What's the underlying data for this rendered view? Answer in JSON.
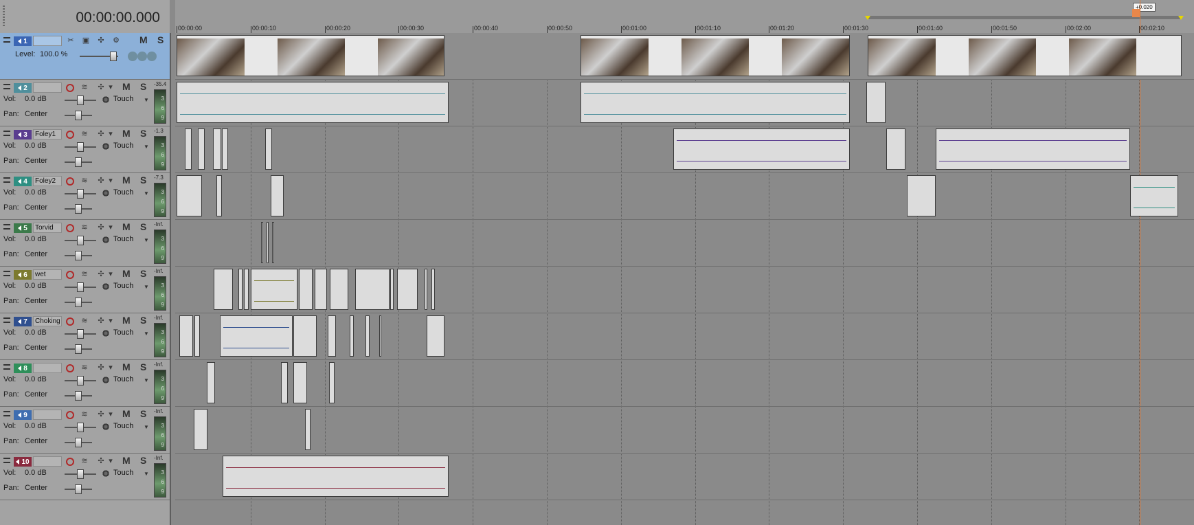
{
  "header": {
    "timecode": "00:00:00.000"
  },
  "ruler": {
    "ticks": [
      "00:00:00",
      "00:00:10",
      "00:00:20",
      "00:00:30",
      "00:00:40",
      "00:00:50",
      "00:01:00",
      "00:01:10",
      "00:01:20",
      "00:01:30",
      "00:01:40",
      "00:01:50",
      "00:02:00",
      "00:02:10"
    ],
    "marker_label": "+0.020"
  },
  "video_track": {
    "number": "1",
    "level_label": "Level:",
    "level_value": "100.0 %",
    "mute": "M",
    "solo": "S"
  },
  "audio_tracks": [
    {
      "number": "2",
      "name": "",
      "peak": "-35.4",
      "color": "#4f8f9c"
    },
    {
      "number": "3",
      "name": "Foley1",
      "peak": "-1.3",
      "color": "#5a3d8f"
    },
    {
      "number": "4",
      "name": "Foley2",
      "peak": "-7.3",
      "color": "#2e8f82"
    },
    {
      "number": "5",
      "name": "Torvid",
      "peak": "-Inf.",
      "color": "#3b7a4a"
    },
    {
      "number": "6",
      "name": "wet",
      "peak": "-Inf.",
      "color": "#7c7a2f"
    },
    {
      "number": "7",
      "name": "Choking",
      "peak": "-Inf.",
      "color": "#2f4f8f"
    },
    {
      "number": "8",
      "name": "",
      "peak": "-Inf.",
      "color": "#2e8f5a"
    },
    {
      "number": "9",
      "name": "",
      "peak": "-Inf.",
      "color": "#3e6db0"
    },
    {
      "number": "10",
      "name": "",
      "peak": "-Inf.",
      "color": "#8a2a3e"
    }
  ],
  "labels": {
    "vol": "Vol:",
    "vol_value": "0.0 dB",
    "pan": "Pan:",
    "pan_value": "Center",
    "touch": "Touch",
    "mute": "M",
    "solo": "S",
    "meter_marks": [
      "3",
      "6",
      "9"
    ]
  }
}
